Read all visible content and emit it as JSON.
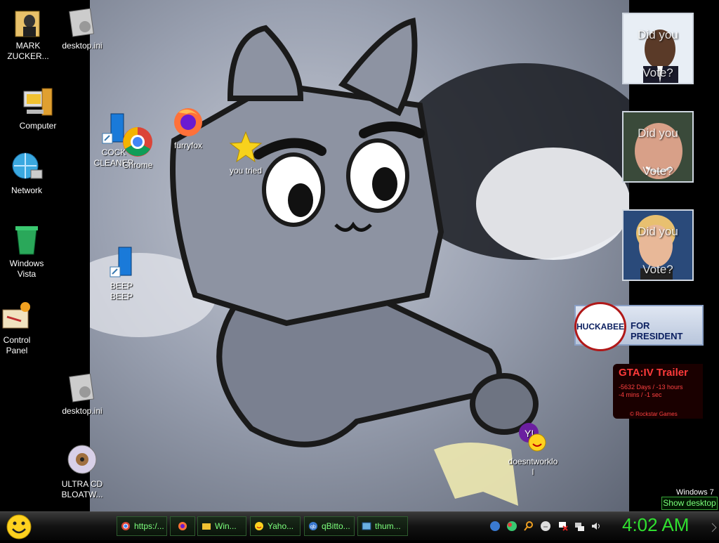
{
  "desktop": {
    "icons": [
      {
        "label": "MARK ZUCKER...",
        "icon": "folder-person-icon"
      },
      {
        "label": "desktop.ini",
        "icon": "ini-file-icon"
      },
      {
        "label": "Computer",
        "icon": "computer-icon"
      },
      {
        "label": "COCK CLEANER",
        "icon": "blue-shortcut-icon"
      },
      {
        "label": "Chrome",
        "icon": "chrome-icon"
      },
      {
        "label": "furryfox",
        "icon": "firefox-icon"
      },
      {
        "label": "you tried",
        "icon": "star-icon"
      },
      {
        "label": "Network",
        "icon": "globe-network-icon"
      },
      {
        "label": "Windows Vista",
        "icon": "recycle-bin-icon"
      },
      {
        "label": "BEEP BEEP",
        "icon": "blue-shortcut-icon"
      },
      {
        "label": "Control Panel",
        "icon": "control-panel-icon"
      },
      {
        "label": "desktop.ini",
        "icon": "ini-file-icon"
      },
      {
        "label": "ULTRA CD BLOATW...",
        "icon": "cd-icon"
      },
      {
        "label": "doesntworklol",
        "icon": "yahoo-messenger-icon"
      }
    ]
  },
  "gadgets": {
    "posters": [
      {
        "line1": "Did you",
        "line2": "Vote?"
      },
      {
        "line1": "Did you",
        "line2": "Vote?"
      },
      {
        "line1": "Did you",
        "line2": "Vote?"
      }
    ],
    "huckabee": {
      "name": "HUCKABEE",
      "tag": "FOR PRESIDENT"
    },
    "gta": {
      "title": "GTA:IV  Trailer",
      "countdown1": "-5632 Days / -13 hours",
      "countdown2": "-4 mins / -1 sec",
      "credit": "©  Rockstar Games"
    }
  },
  "os_label": "Windows 7",
  "show_desktop": "Show desktop",
  "taskbar": {
    "tasks": [
      {
        "label": "https:/...",
        "icon": "chrome-icon"
      },
      {
        "label": "",
        "icon": "firefox-icon"
      },
      {
        "label": "Win...",
        "icon": "folder-icon"
      },
      {
        "label": "Yaho...",
        "icon": "yahoo-smiley-icon"
      },
      {
        "label": "qBitto...",
        "icon": "qbittorrent-icon"
      },
      {
        "label": "thum...",
        "icon": "image-viewer-icon"
      }
    ],
    "clock": "4:02 AM"
  },
  "colors": {
    "taskbar_text": "#7cff7c",
    "clock": "#30e030",
    "gta_red": "#ff3b3b"
  }
}
